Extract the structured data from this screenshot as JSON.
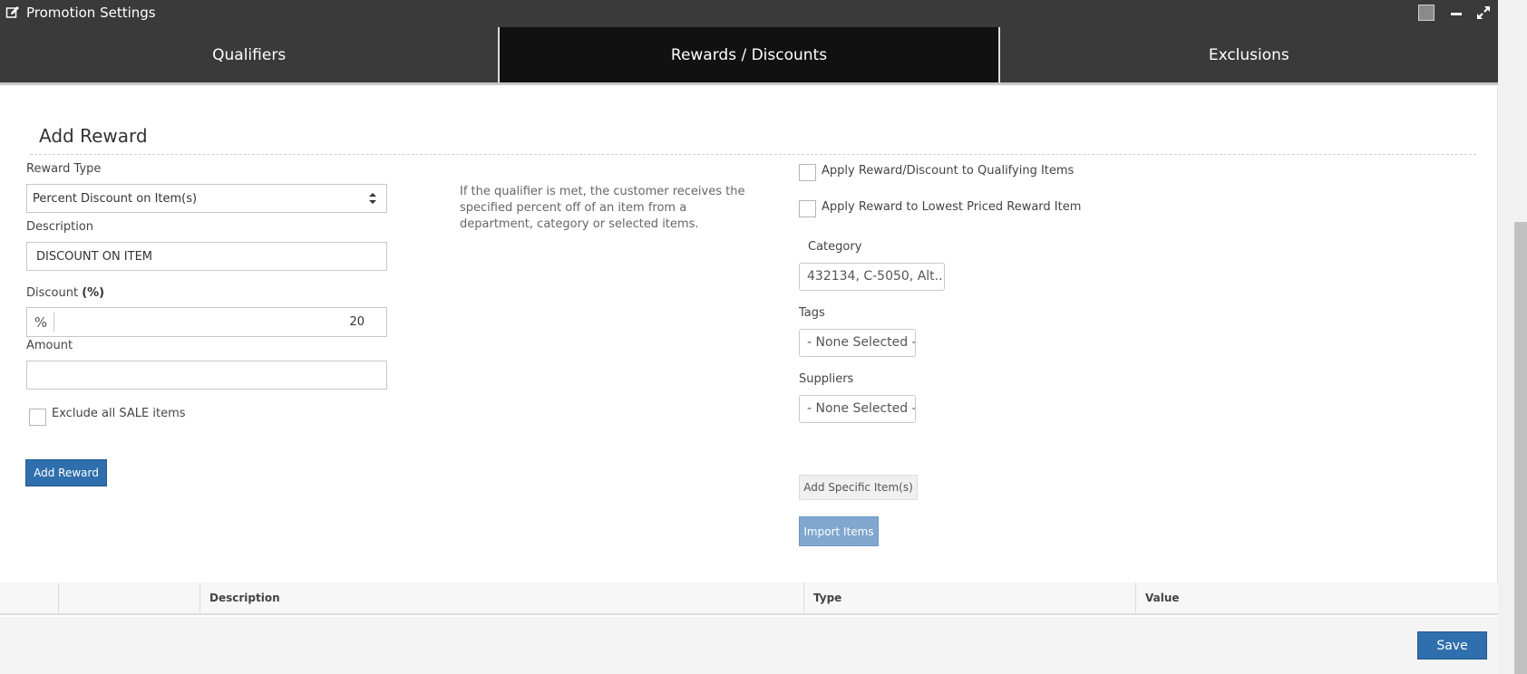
{
  "window": {
    "title": "Promotion Settings"
  },
  "tabs": [
    {
      "label": "Qualifiers",
      "active": false
    },
    {
      "label": "Rewards / Discounts",
      "active": true
    },
    {
      "label": "Exclusions",
      "active": false
    }
  ],
  "form": {
    "section_title": "Add Reward",
    "reward_type_label": "Reward Type",
    "reward_type_value": "Percent Discount on Item(s)",
    "description_label": "Description",
    "description_value": "DISCOUNT ON ITEM",
    "discount_label": "Discount",
    "discount_unit": "(%)",
    "discount_addon": "%",
    "discount_value": "20",
    "amount_label": "Amount",
    "amount_value": "",
    "exclude_sale_label": "Exclude all SALE items",
    "exclude_sale_checked": false,
    "add_reward_button": "Add Reward"
  },
  "info": {
    "text": "If the qualifier is met, the customer receives the specified percent off of an item from a department, category or selected items."
  },
  "options": {
    "apply_qualifying_label": "Apply Reward/Discount to Qualifying Items",
    "apply_qualifying_checked": false,
    "apply_lowest_label": "Apply Reward to Lowest Priced Reward Item",
    "apply_lowest_checked": false,
    "category_label": "Category",
    "category_value": "432134, C-5050, Alt...",
    "tags_label": "Tags",
    "tags_value": "- None Selected -",
    "suppliers_label": "Suppliers",
    "suppliers_value": "- None Selected -",
    "add_specific_button": "Add Specific Item(s)",
    "import_button": "Import Items"
  },
  "table": {
    "columns": [
      "Description",
      "Type",
      "Value"
    ]
  },
  "footer": {
    "save_button": "Save"
  },
  "colors": {
    "titlebar": "#3a3a3a",
    "active_tab": "#111111",
    "primary": "#2f6fad",
    "muted_primary": "#7fa7cf"
  }
}
